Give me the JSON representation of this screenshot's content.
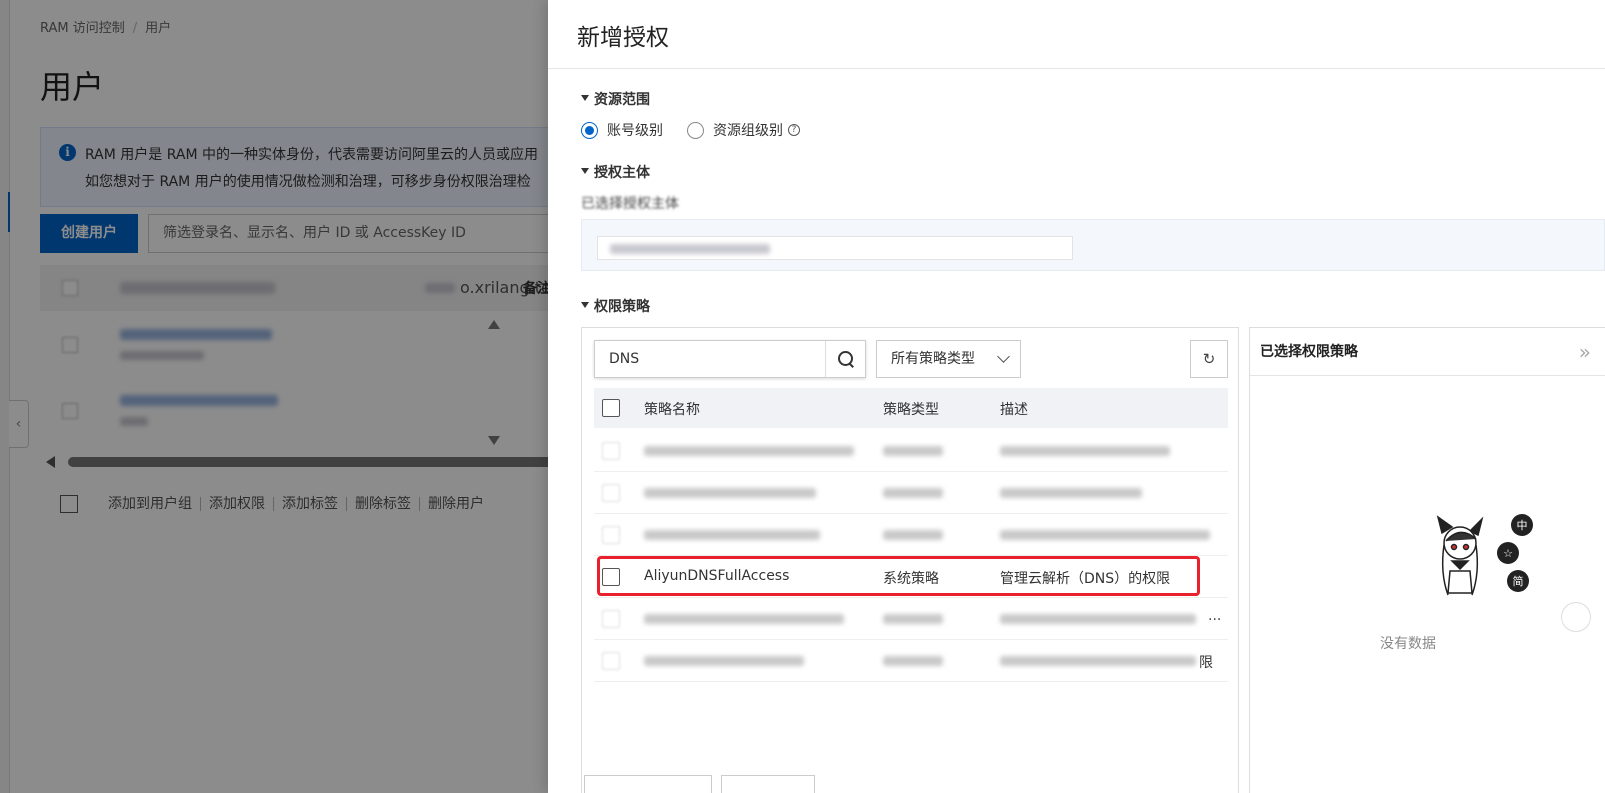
{
  "background_page": {
    "breadcrumb": [
      "RAM 访问控制",
      "用户"
    ],
    "breadcrumb_sep": "/",
    "title": "用户",
    "info_line1": "RAM 用户是 RAM 中的一种实体身份，代表需要访问阿里云的人员或应用",
    "info_line2": "如您想对于 RAM 用户的使用情况做检测和治理，可移步身份权限治理检",
    "info_icon": "i",
    "create_button": "创建用户",
    "filter_placeholder": "筛选登录名、显示名、用户 ID 或 AccessKey ID",
    "row1_domain": "o.xrilang.top",
    "row1_note": "备注",
    "bulk_actions": [
      "添加到用户组",
      "添加权限",
      "添加标签",
      "删除标签",
      "删除用户"
    ]
  },
  "drawer": {
    "title": "新增授权",
    "resource_scope": {
      "heading": "资源范围",
      "options": [
        "账号级别",
        "资源组级别"
      ],
      "selected": "账号级别",
      "help": "?"
    },
    "principal": {
      "heading": "授权主体",
      "selected_label": "已选择授权主体"
    },
    "policy": {
      "heading": "权限策略",
      "search_value": "DNS",
      "type_select": "所有策略类型",
      "refresh_icon": "↻",
      "columns": {
        "name": "策略名称",
        "type": "策略类型",
        "desc": "描述"
      },
      "highlighted_row": {
        "name": "AliyunDNSFullAccess",
        "type": "系统策略",
        "desc": "管理云解析（DNS）的权限"
      },
      "row5_tail": "...",
      "row6_tail": "限"
    },
    "selected_policies": {
      "heading": "已选择权限策略",
      "expand_icon": "»",
      "empty_text": "没有数据"
    }
  },
  "colors": {
    "primary": "#0064c8",
    "highlight": "#e8212d",
    "overlay": "rgba(0,0,0,0.45)"
  }
}
